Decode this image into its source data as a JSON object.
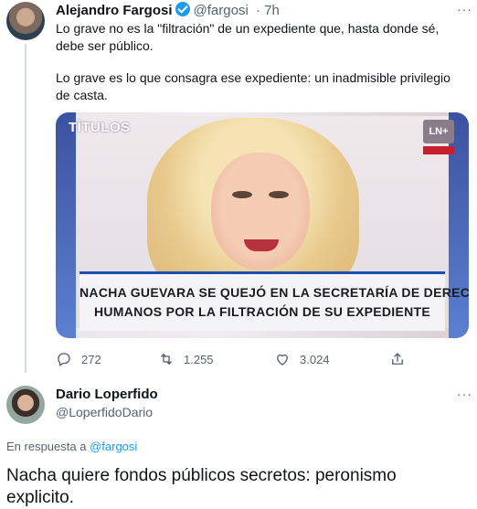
{
  "tweet1": {
    "author_name": "Alejandro Fargosi",
    "handle": "@fargosi",
    "separator": "·",
    "time": "7h",
    "more_label": "···",
    "paragraph1": "Lo grave no es la \"filtración\" de un expediente que, hasta donde sé, debe ser público.",
    "paragraph2": "Lo grave es lo que consagra ese expediente: un inadmisible privilegio de casta.",
    "media": {
      "section_label": "TÍTULOS",
      "channel_logo": "LN+",
      "headline_line1": "NACHA GUEVARA SE QUEJÓ EN LA SECRETARÍA DE DERECHOS",
      "headline_line2": "HUMANOS POR LA FILTRACIÓN DE SU EXPEDIENTE"
    },
    "actions": {
      "reply_count": "272",
      "retweet_count": "1.255",
      "like_count": "3.024",
      "icons": [
        "reply-icon",
        "retweet-icon",
        "like-icon",
        "share-icon"
      ]
    }
  },
  "tweet2": {
    "author_name": "Dario Loperfido",
    "handle": "@LoperfidoDario",
    "more_label": "···",
    "reply_prefix": "En respuesta a",
    "reply_handle": "@fargosi",
    "body": "Nacha quiere fondos públicos secretos: peronismo explicito."
  },
  "colors": {
    "accent": "#1d9bf0",
    "muted": "#536471",
    "text": "#0f1419",
    "divider": "#cfd9de",
    "banner_blue": "#1b4fb4"
  }
}
